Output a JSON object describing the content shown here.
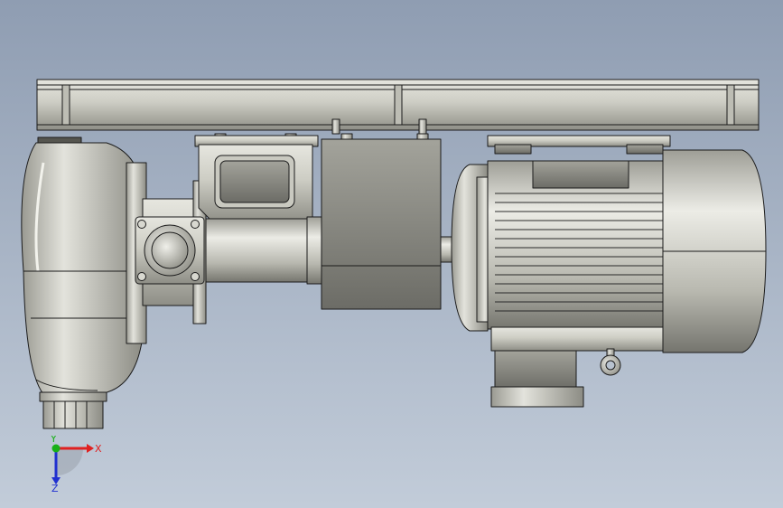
{
  "viewport": {
    "background_top": "#8f9db2",
    "background_bottom": "#c2ccd9",
    "edge_color": "#1b1b1b",
    "part_color": "#cfcfc6",
    "part_shade": "#8d8d85"
  },
  "triad": {
    "x_label": "X",
    "y_label": "Y",
    "z_label": "Z",
    "x_color": "#e02020",
    "y_color": "#18b018",
    "z_color": "#2030d0"
  }
}
